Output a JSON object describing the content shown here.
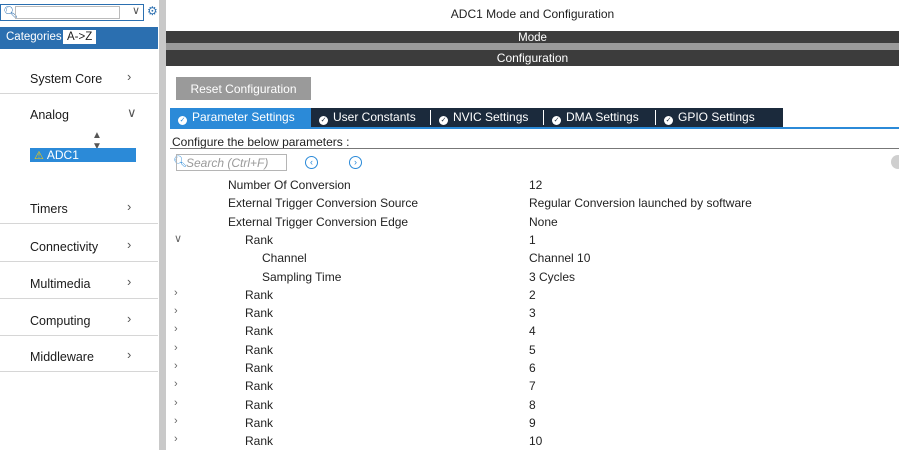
{
  "sidebar": {
    "tabs": {
      "categories": "Categories",
      "az": "A->Z"
    },
    "categories": [
      {
        "label": "System Core",
        "chevron": ">"
      },
      {
        "label": "Analog",
        "chevron": "v"
      },
      {
        "label": "Timers",
        "chevron": ">"
      },
      {
        "label": "Connectivity",
        "chevron": ">"
      },
      {
        "label": "Multimedia",
        "chevron": ">"
      },
      {
        "label": "Computing",
        "chevron": ">"
      },
      {
        "label": "Middleware",
        "chevron": ">"
      }
    ],
    "selected_item": "ADC1"
  },
  "main": {
    "title": "ADC1 Mode and Configuration",
    "mode_label": "Mode",
    "configuration_label": "Configuration",
    "reset_button": "Reset Configuration",
    "tabs": [
      {
        "label": "Parameter Settings",
        "active": true
      },
      {
        "label": "User Constants",
        "active": false
      },
      {
        "label": "NVIC Settings",
        "active": false
      },
      {
        "label": "DMA Settings",
        "active": false
      },
      {
        "label": "GPIO Settings",
        "active": false
      }
    ],
    "configure_label": "Configure the below parameters :",
    "search_placeholder": "Search (Ctrl+F)",
    "params": [
      {
        "name": "Number Of Conversion",
        "value": "12",
        "arrow": "",
        "indent": 0
      },
      {
        "name": "External Trigger Conversion Source",
        "value": "Regular Conversion launched by software",
        "arrow": "",
        "indent": 0
      },
      {
        "name": "External Trigger Conversion Edge",
        "value": "None",
        "arrow": "",
        "indent": 0
      },
      {
        "name": "Rank",
        "value": "1",
        "arrow": "v",
        "indent": 1
      },
      {
        "name": "Channel",
        "value": "Channel 10",
        "arrow": "",
        "indent": 2
      },
      {
        "name": "Sampling Time",
        "value": "3 Cycles",
        "arrow": "",
        "indent": 2
      },
      {
        "name": "Rank",
        "value": "2",
        "arrow": ">",
        "indent": 1
      },
      {
        "name": "Rank",
        "value": "3",
        "arrow": ">",
        "indent": 1
      },
      {
        "name": "Rank",
        "value": "4",
        "arrow": ">",
        "indent": 1
      },
      {
        "name": "Rank",
        "value": "5",
        "arrow": ">",
        "indent": 1
      },
      {
        "name": "Rank",
        "value": "6",
        "arrow": ">",
        "indent": 1
      },
      {
        "name": "Rank",
        "value": "7",
        "arrow": ">",
        "indent": 1
      },
      {
        "name": "Rank",
        "value": "8",
        "arrow": ">",
        "indent": 1
      },
      {
        "name": "Rank",
        "value": "9",
        "arrow": ">",
        "indent": 1
      },
      {
        "name": "Rank",
        "value": "10",
        "arrow": ">",
        "indent": 1
      }
    ]
  }
}
